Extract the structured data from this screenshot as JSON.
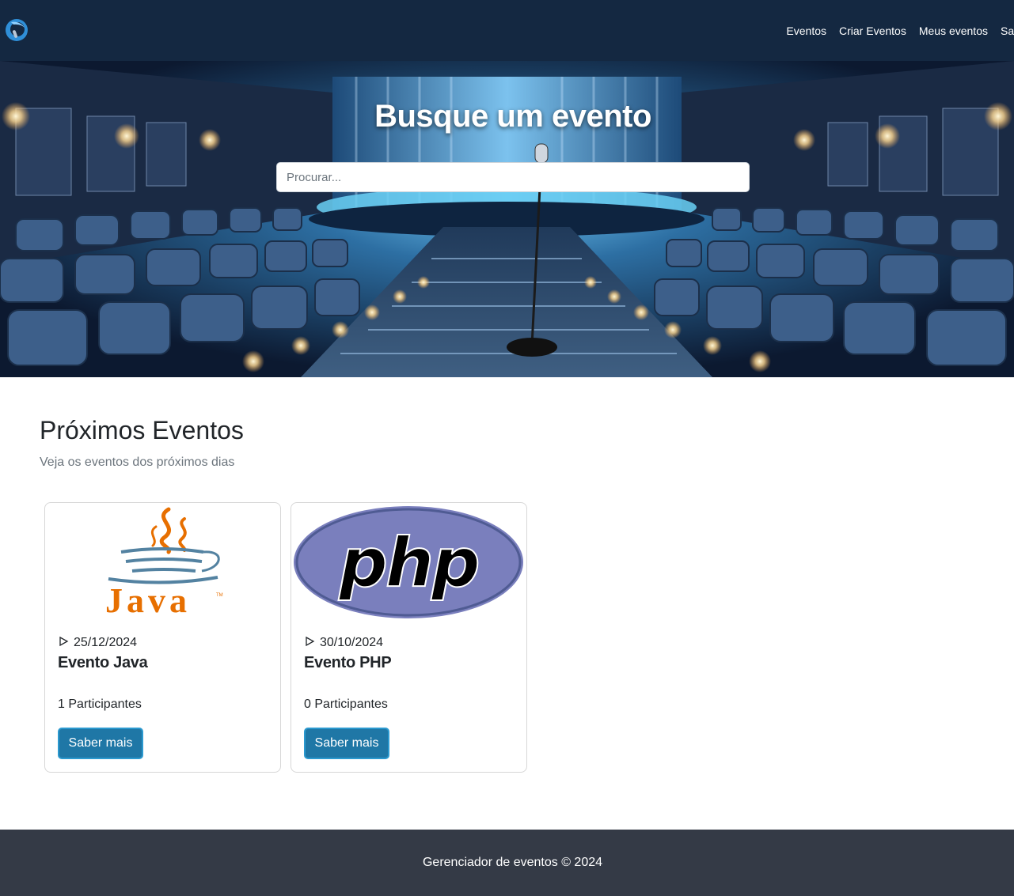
{
  "nav": {
    "logo_icon": "globe-logo-icon",
    "links": [
      "Eventos",
      "Criar Eventos",
      "Meus eventos",
      "Sair"
    ]
  },
  "hero": {
    "title": "Busque um evento",
    "search_placeholder": "Procurar..."
  },
  "section": {
    "title": "Próximos Eventos",
    "subtitle": "Veja os eventos dos próximos dias"
  },
  "events": [
    {
      "logo": "java-logo",
      "date": "25/12/2024",
      "title": "Evento Java",
      "participants": "1 Participantes",
      "button": "Saber mais"
    },
    {
      "logo": "php-logo",
      "logo_text": "php",
      "date": "30/10/2024",
      "title": "Evento PHP",
      "participants": "0 Participantes",
      "button": "Saber mais"
    }
  ],
  "footer": {
    "text": "Gerenciador de eventos © 2024"
  },
  "colors": {
    "navbar": "#142841",
    "button": "#1f77a6",
    "footer": "#343a46"
  }
}
